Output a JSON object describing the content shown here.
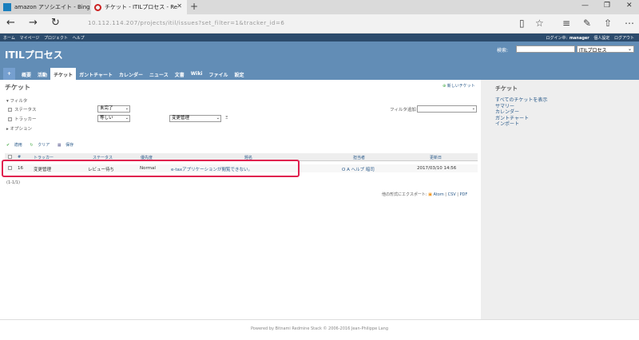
{
  "browser": {
    "tabs": [
      {
        "label": "amazon アソシエイト - Bing",
        "icon": "bing-icon"
      },
      {
        "label": "チケット - ITILプロセス - Re",
        "icon": "redmine-icon"
      }
    ],
    "new_tab": "+",
    "window_controls": [
      "—",
      "❐",
      "✕"
    ],
    "nav": {
      "back": "←",
      "forward": "→",
      "refresh": "↻"
    },
    "url": "10.112.114.207/projects/itil/issues?set_filter=1&tracker_id=6",
    "toolbar_icons": [
      "▯",
      "☆",
      "≡",
      "✎",
      "⇧",
      "⋯"
    ]
  },
  "topmenu": {
    "left": [
      "ホーム",
      "マイページ",
      "プロジェクト",
      "ヘルプ"
    ],
    "right": [
      "ログイン中:",
      "manager",
      "個人設定",
      "ログアウト"
    ]
  },
  "header": {
    "title": "ITILプロセス",
    "search_label": "検索:",
    "search_placeholder": "",
    "project_select": "ITILプロセス",
    "tabs": [
      "+",
      "概要",
      "活動",
      "チケット",
      "ガントチャート",
      "カレンダー",
      "ニュース",
      "文書",
      "Wiki",
      "ファイル",
      "設定"
    ],
    "active_tab": "チケット"
  },
  "main": {
    "title": "チケット",
    "new_ticket": "新しいチケット",
    "filter_legend": "フィルタ",
    "filters": [
      {
        "label": "ステータス",
        "operator": "未完了"
      },
      {
        "label": "トラッカー",
        "operator": "等しい",
        "value": "変更管理",
        "extra": "Ξ"
      }
    ],
    "add_filter_label": "フィルタ追加",
    "options_legend": "オプション",
    "actions": {
      "apply": "適用",
      "clear": "クリア",
      "save": "保存"
    },
    "columns": [
      "#",
      "トラッカー",
      "ステータス",
      "優先度",
      "題名",
      "担当者",
      "更新日"
    ],
    "rows": [
      {
        "id": "16",
        "tracker": "変更管理",
        "status": "レビュー待ち",
        "priority": "Normal",
        "subject": "e-taxアプリケーションが閲覧できない。",
        "assignee": "O A ヘルプ 暗司",
        "updated": "2017/03/10 14:56"
      }
    ],
    "count": "(1-1/1)",
    "export_label": "他の形式にエクスポート:",
    "export_links": [
      "Atom",
      "CSV",
      "PDF"
    ]
  },
  "sidebar": {
    "title": "チケット",
    "links": [
      "すべてのチケットを表示",
      "サマリー",
      "カレンダー",
      "ガントチャート",
      "インポート"
    ]
  },
  "footer": {
    "text": "Powered by Bitnami Redmine Stack © 2006-2016 Jean-Philippe Lang"
  },
  "colors": {
    "header": "#628db6",
    "topmenu": "#2c4b6c",
    "highlight": "#e0204f"
  }
}
